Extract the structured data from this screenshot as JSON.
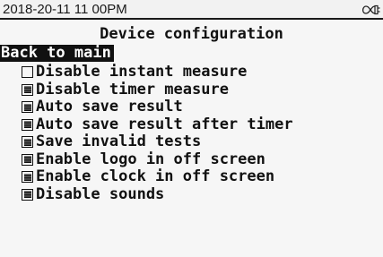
{
  "status_bar": {
    "datetime": "2018-20-11 11 00PM",
    "status_icon": "loop-plug-icon"
  },
  "title": "Device configuration",
  "back_item": {
    "label": "Back to main",
    "selected": true
  },
  "options": [
    {
      "label": "Disable instant measure",
      "checked": false
    },
    {
      "label": "Disable timer measure",
      "checked": true
    },
    {
      "label": "Auto save result",
      "checked": true
    },
    {
      "label": "Auto save result after timer",
      "checked": true
    },
    {
      "label": "Save invalid tests",
      "checked": true
    },
    {
      "label": "Enable logo in off screen",
      "checked": true
    },
    {
      "label": "Enable clock in off screen",
      "checked": true
    },
    {
      "label": "Disable sounds",
      "checked": true
    }
  ]
}
